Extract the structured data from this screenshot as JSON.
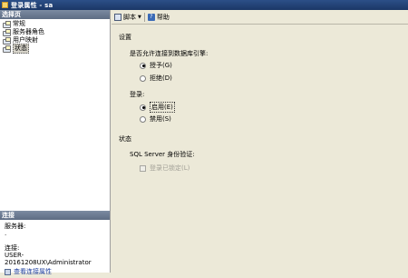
{
  "window": {
    "title": "登录属性 - sa"
  },
  "left_panel": {
    "select_page_header": "选择页",
    "nav_items": [
      {
        "label": "常规",
        "icon": "page-icon"
      },
      {
        "label": "服务器角色",
        "icon": "page-icon"
      },
      {
        "label": "用户映射",
        "icon": "page-icon"
      },
      {
        "label": "状态",
        "icon": "page-icon",
        "selected": true
      }
    ],
    "connection": {
      "header": "连接",
      "server_label": "服务器:",
      "server_value": ".",
      "connect_label": "连接:",
      "connect_value": "USER-20161208UX\\Administrator",
      "view_props_link": "查看连接属性"
    }
  },
  "toolbar": {
    "script_label": "脚本",
    "help_label": "帮助"
  },
  "settings": {
    "section_title": "设置",
    "db_engine_question": "是否允许连接到数据库引擎:",
    "grant_label": "授予(G)",
    "deny_label": "拒绝(D)",
    "login_title": "登录:",
    "enable_label": "启用(E)",
    "disable_label": "禁用(S)",
    "grant_selected": true,
    "enable_selected": true
  },
  "status": {
    "section_title": "状态",
    "auth_label": "SQL Server 身份验证:",
    "locked_label": "登录已锁定(L)",
    "locked_checked": false
  }
}
